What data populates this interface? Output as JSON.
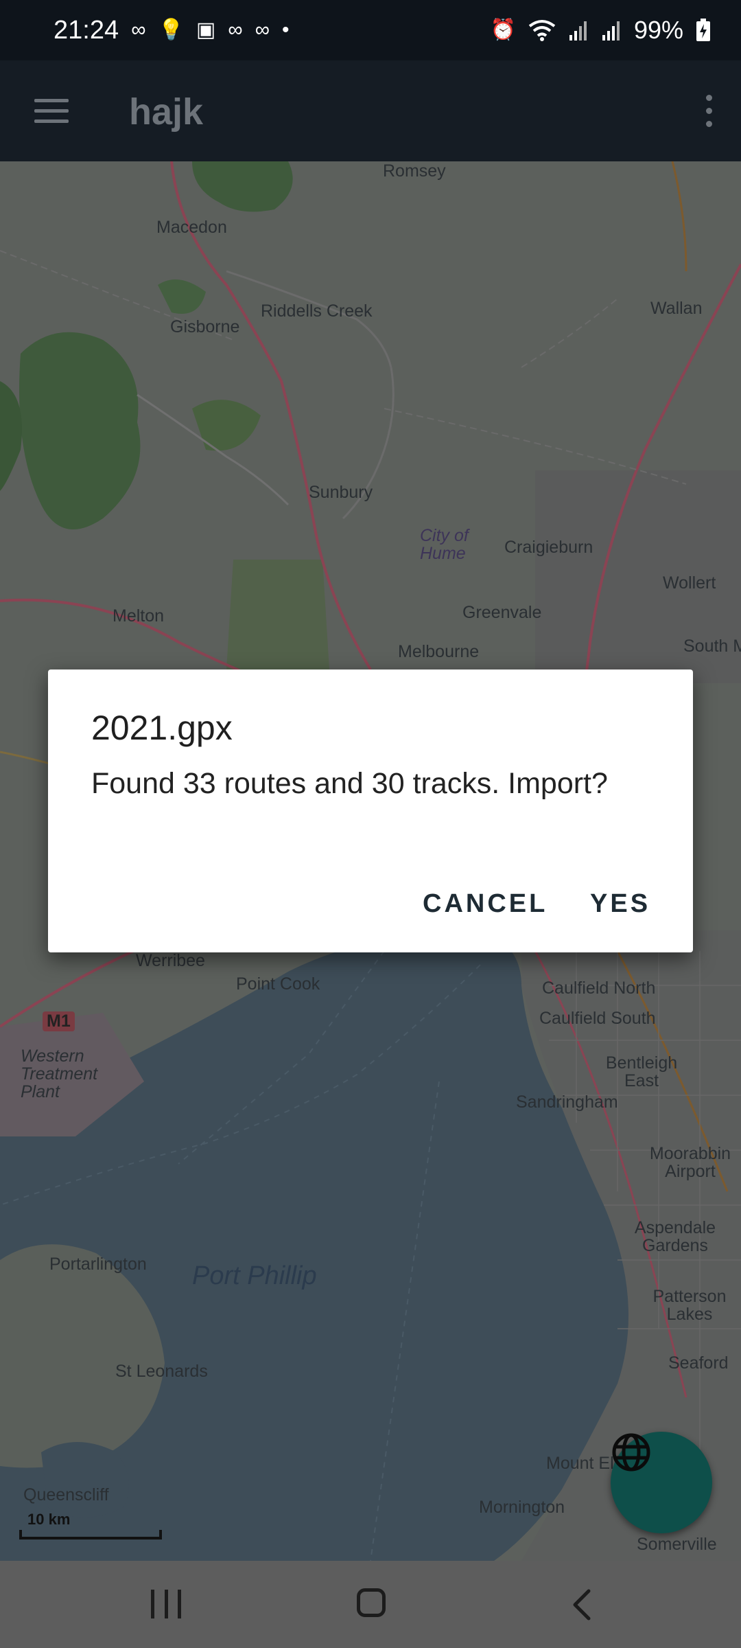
{
  "status_bar": {
    "time": "21:24",
    "left_icons": [
      "voicemail-icon",
      "bulb-icon",
      "image-icon",
      "voicemail-icon",
      "voicemail-icon",
      "dot-icon"
    ],
    "right_icons": [
      "alarm-icon",
      "wifi-icon",
      "signal-icon",
      "signal-roaming-icon"
    ],
    "battery": "99%"
  },
  "app_bar": {
    "title": "hajk",
    "menu_icon": "hamburger-menu-icon",
    "overflow_icon": "more-vert-icon"
  },
  "map": {
    "labels": {
      "romsey": "Romsey",
      "macedon": "Macedon",
      "wallan": "Wallan",
      "riddells_creek": "Riddells Creek",
      "gisborne": "Gisborne",
      "sunbury": "Sunbury",
      "city_of_hume": "City of Hume",
      "craigieburn": "Craigieburn",
      "wollert": "Wollert",
      "melton": "Melton",
      "greenvale": "Greenvale",
      "melbourne_airport": "Melbourne",
      "south_morang": "South M",
      "werribee": "Werribee",
      "point_cook": "Point Cook",
      "m1": "M1",
      "western_treatment_plant": "Western Treatment Plant",
      "caulfield_north": "Caulfield North",
      "caulfield_south": "Caulfield South",
      "bentleigh_east": "Bentleigh East",
      "sandringham": "Sandringham",
      "moorabbin_airport": "Moorabbin Airport",
      "aspendale_gardens": "Aspendale Gardens",
      "portarlington": "Portarlington",
      "port_phillip": "Port Phillip",
      "patterson_lakes": "Patterson Lakes",
      "st_leonards": "St Leonards",
      "seaford": "Seaford",
      "queenscliff": "Queenscliff",
      "mount_eliza": "Mount El",
      "mornington": "Mornington",
      "somerville": "Somerville"
    },
    "scale": "10 km"
  },
  "dialog": {
    "title": "2021.gpx",
    "message": "Found 33 routes and 30 tracks. Import?",
    "cancel_label": "CANCEL",
    "yes_label": "YES"
  },
  "fab": {
    "icon": "globe-icon"
  },
  "nav_bar": {
    "recent_icon": "recent-apps-icon",
    "home_icon": "home-icon",
    "back_icon": "back-icon"
  }
}
